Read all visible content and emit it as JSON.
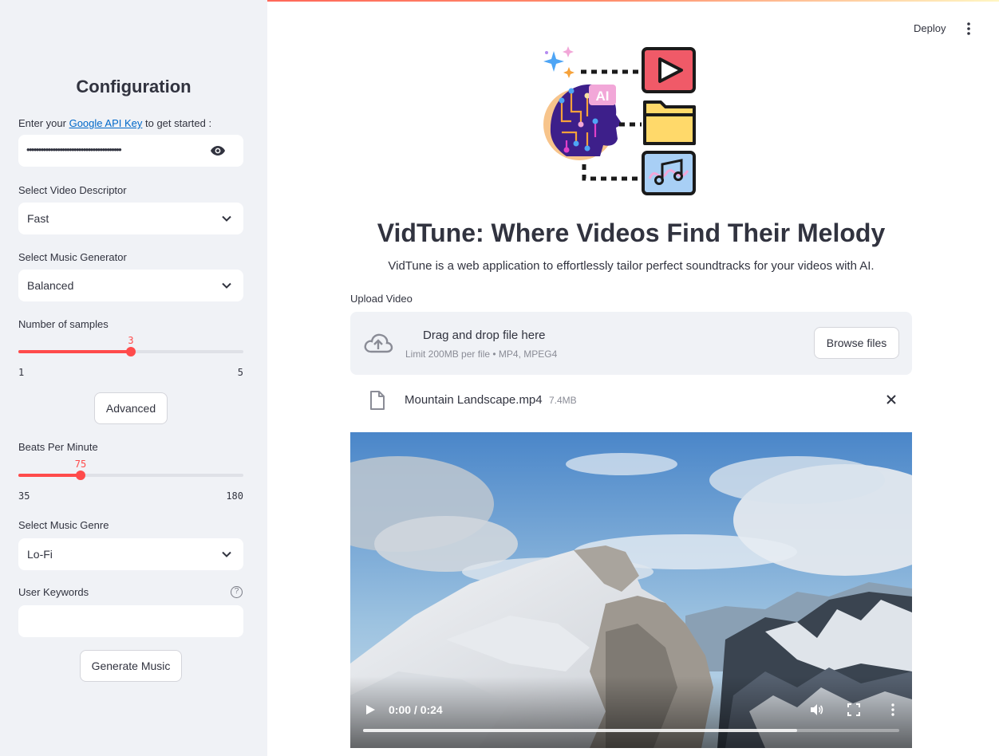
{
  "sidebar": {
    "title": "Configuration",
    "api_key": {
      "label_prefix": "Enter your ",
      "label_link": "Google API Key",
      "label_suffix": " to get started :",
      "masked_value": "••••••••••••••••••••••••••••••••••••••••",
      "icon": "eye-icon"
    },
    "video_descriptor": {
      "label": "Select Video Descriptor",
      "value": "Fast"
    },
    "music_generator": {
      "label": "Select Music Generator",
      "value": "Balanced"
    },
    "samples": {
      "label": "Number of samples",
      "value": "3",
      "min": "1",
      "max": "5"
    },
    "advanced_button": "Advanced",
    "bpm": {
      "label": "Beats Per Minute",
      "value": "75",
      "min": "35",
      "max": "180"
    },
    "genre": {
      "label": "Select Music Genre",
      "value": "Lo-Fi"
    },
    "keywords": {
      "label": "User Keywords",
      "value": "",
      "help_glyph": "?"
    },
    "generate_button": "Generate Music"
  },
  "header": {
    "deploy": "Deploy"
  },
  "main": {
    "title": "VidTune: Where Videos Find Their Melody",
    "subtitle": "VidTune is a web application to effortlessly tailor perfect soundtracks for your videos with AI.",
    "logo_text": "AI",
    "uploader": {
      "label": "Upload Video",
      "drop_text": "Drag and drop file here",
      "limit_text": "Limit 200MB per file • MP4, MPEG4",
      "browse_button": "Browse files"
    },
    "file": {
      "name": "Mountain Landscape.mp4",
      "size": "7.4MB"
    },
    "video": {
      "time": "0:00 / 0:24",
      "progress_fraction": 0.81
    }
  },
  "colors": {
    "accent": "#ff4b4b",
    "sidebar_bg": "#f0f2f6",
    "text": "#31333f",
    "link": "#0068c9"
  }
}
